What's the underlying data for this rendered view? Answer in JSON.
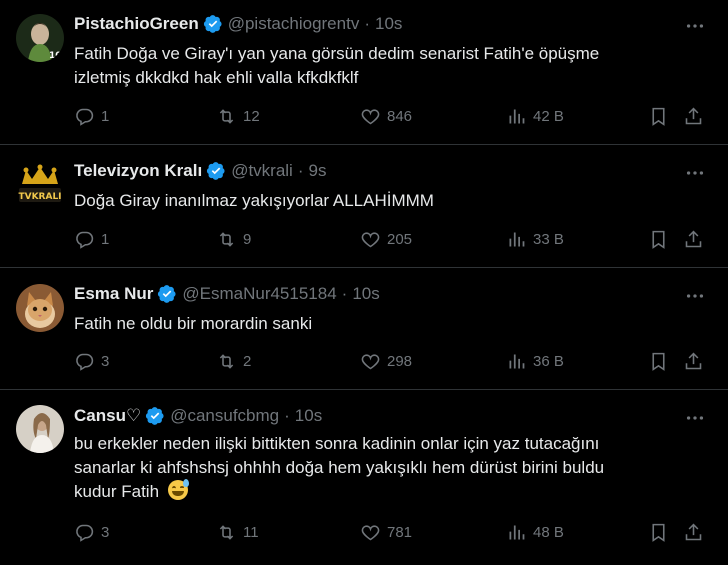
{
  "tweets": [
    {
      "display_name": "PistachioGreen",
      "handle": "@pistachiogrentv",
      "time": "10s",
      "text_lines": [
        "Fatih Doğa ve Giray'ı yan yana görsün dedim senarist Fatih'e öpüşme",
        "izletmiş dkkdkd hak ehli valla kfkdkfklf"
      ],
      "replies": "1",
      "retweets": "12",
      "likes": "846",
      "views": "42 B",
      "avatar_colors": [
        "#2a3a22",
        "#6d8f4e"
      ]
    },
    {
      "display_name": "Televizyon Kralı",
      "handle": "@tvkrali",
      "time": "9s",
      "text_lines": [
        "Doğa Giray inanılmaz yakışıyorlar ALLAHİMMM"
      ],
      "replies": "1",
      "retweets": "9",
      "likes": "205",
      "views": "33 B",
      "avatar_text": "TVKRALI"
    },
    {
      "display_name": "Esma Nur",
      "handle": "@EsmaNur4515184",
      "time": "10s",
      "text_lines": [
        "Fatih ne oldu bir morardin sanki"
      ],
      "replies": "3",
      "retweets": "2",
      "likes": "298",
      "views": "36 B",
      "avatar_colors": [
        "#c98a4a",
        "#f0d2a8"
      ]
    },
    {
      "display_name": "Cansu♡",
      "handle": "@cansufcbmg",
      "time": "10s",
      "text_lines": [
        "bu erkekler neden ilişki bittikten sonra kadinin onlar için yaz tutacağını",
        "sanarlar ki ahfshshsj ohhhh doğa hem yakışıklı hem dürüst birini buldu",
        "kudur Fatih"
      ],
      "emoji": "😅",
      "replies": "3",
      "retweets": "11",
      "likes": "781",
      "views": "48 B",
      "avatar_colors": [
        "#d9d4cc",
        "#a89a88"
      ]
    }
  ],
  "dot_separator": "·",
  "colors": {
    "accent_verified": "#1d9bf0",
    "muted": "#71767b",
    "divider": "#2f3336"
  }
}
